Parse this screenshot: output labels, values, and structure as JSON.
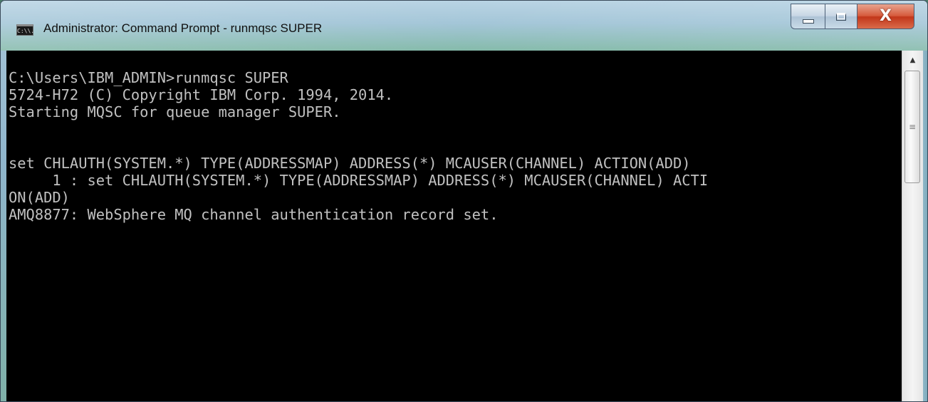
{
  "window": {
    "title": "Administrator: Command Prompt - runmqsc  SUPER",
    "app_icon": "C:\\\\.",
    "icons": {
      "app": "cmd-icon",
      "minimize": "minimize-icon",
      "maximize": "maximize-icon",
      "close": "close-icon"
    },
    "close_glyph": "X"
  },
  "console": {
    "lines": [
      "C:\\Users\\IBM_ADMIN>runmqsc SUPER",
      "5724-H72 (C) Copyright IBM Corp. 1994, 2014.",
      "Starting MQSC for queue manager SUPER.",
      "",
      "",
      "set CHLAUTH(SYSTEM.*) TYPE(ADDRESSMAP) ADDRESS(*) MCAUSER(CHANNEL) ACTION(ADD)",
      "     1 : set CHLAUTH(SYSTEM.*) TYPE(ADDRESSMAP) ADDRESS(*) MCAUSER(CHANNEL) ACTI",
      "ON(ADD)",
      "AMQ8877: WebSphere MQ channel authentication record set."
    ],
    "colors": {
      "background": "#000000",
      "foreground": "#c0c0c0"
    }
  },
  "scrollbar": {
    "up_arrow": "▲",
    "grip": "≡",
    "icons": {
      "up": "scroll-up-arrow-icon",
      "grip": "grip-icon"
    }
  }
}
